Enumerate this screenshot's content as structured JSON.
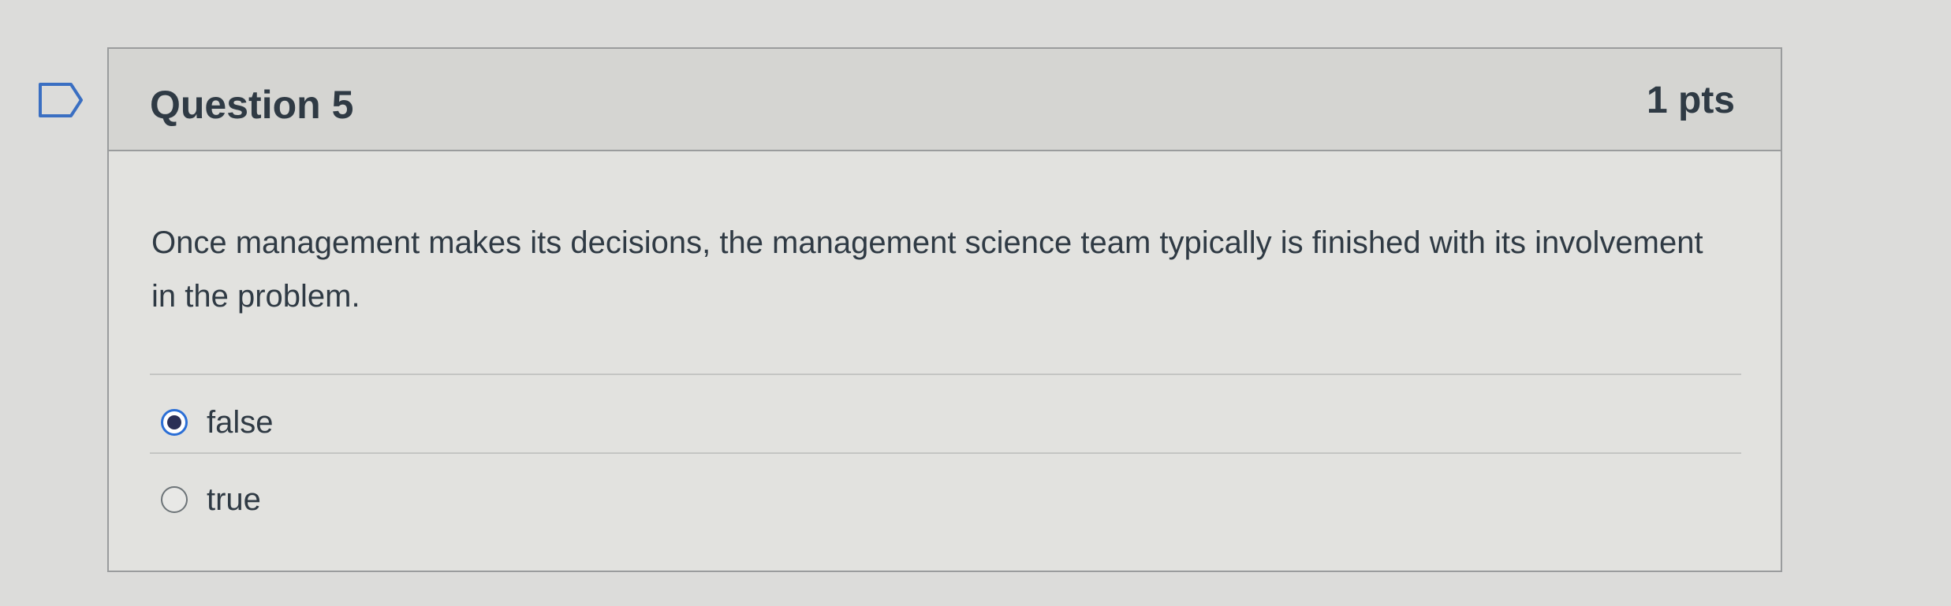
{
  "question": {
    "title": "Question 5",
    "points": "1 pts",
    "text": "Once management makes its decisions, the management science team typically is finished with its involvement in the problem.",
    "bookmark_icon": "bookmark-flag-icon",
    "answers": [
      {
        "label": "false",
        "selected": true
      },
      {
        "label": "true",
        "selected": false
      }
    ]
  },
  "colors": {
    "accent": "#2b6fd6",
    "radio_dot": "#2a2f55",
    "text": "#2f3a44",
    "border": "#9a9c9d"
  }
}
